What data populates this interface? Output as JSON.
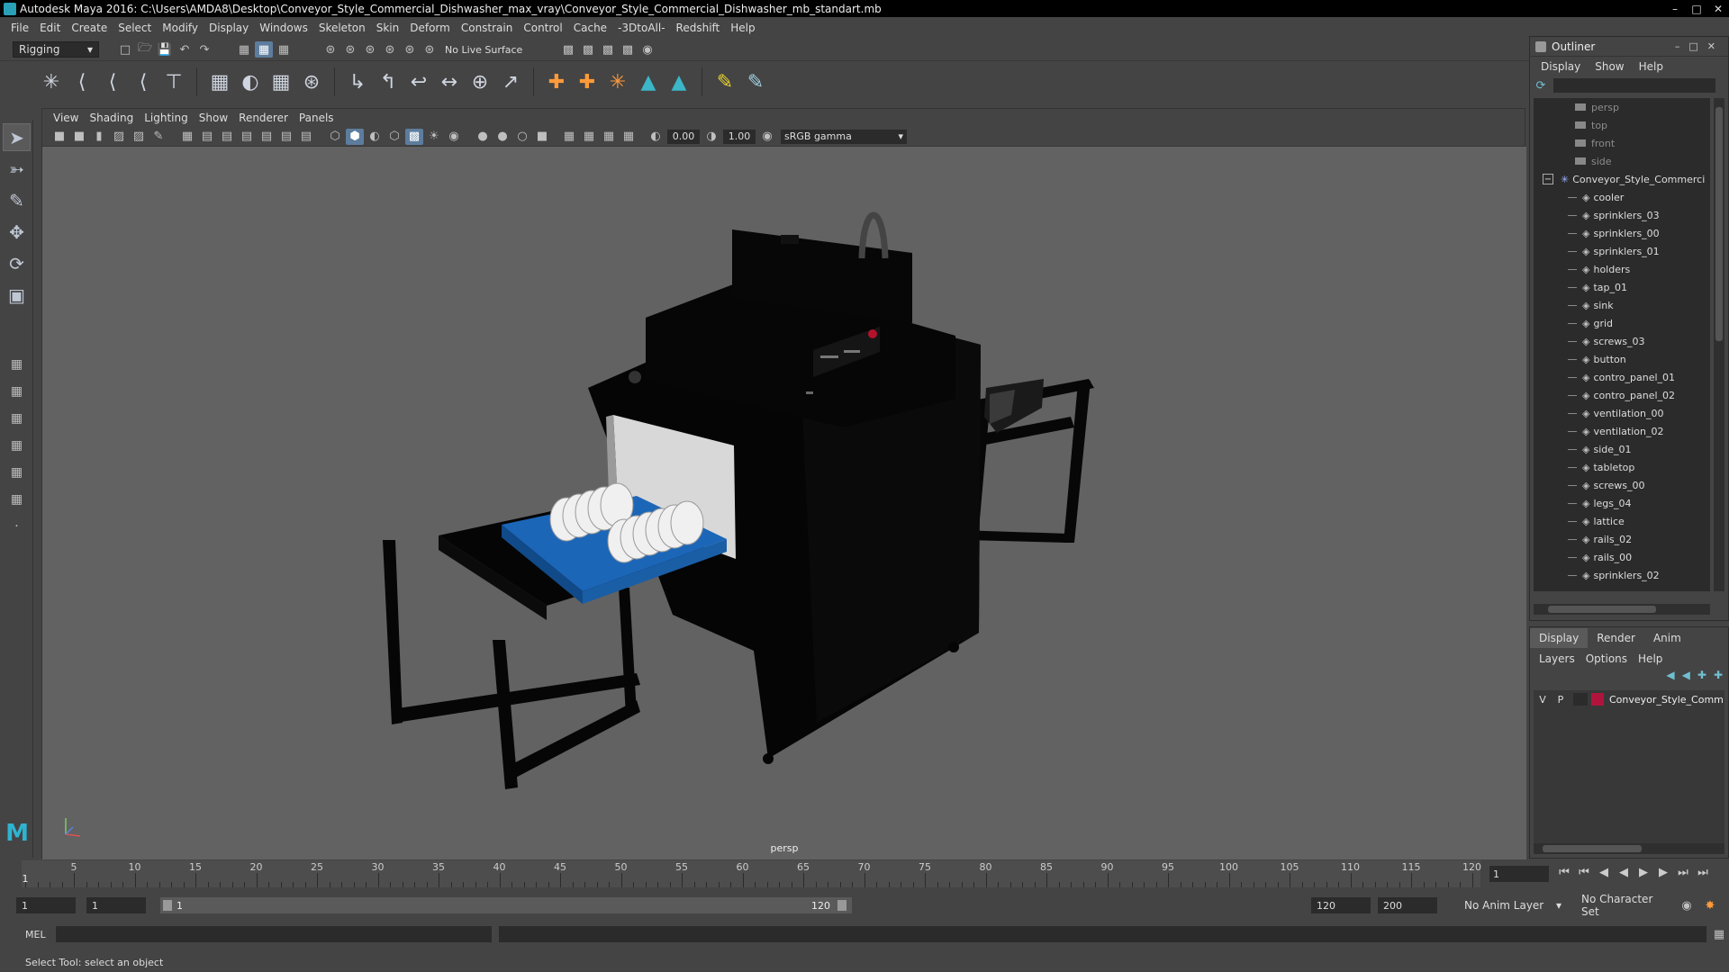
{
  "window": {
    "title": "Autodesk Maya 2016: C:\\Users\\AMDA8\\Desktop\\Conveyor_Style_Commercial_Dishwasher_max_vray\\Conveyor_Style_Commercial_Dishwasher_mb_standart.mb"
  },
  "menu": [
    "File",
    "Edit",
    "Create",
    "Select",
    "Modify",
    "Display",
    "Windows",
    "Skeleton",
    "Skin",
    "Deform",
    "Constrain",
    "Control",
    "Cache",
    "-3DtoAll-",
    "Redshift",
    "Help"
  ],
  "statusline": {
    "menuset": "Rigging",
    "live_surface": "No Live Surface"
  },
  "viewport": {
    "menu": [
      "View",
      "Shading",
      "Lighting",
      "Show",
      "Renderer",
      "Panels"
    ],
    "exposure": "0.00",
    "gamma": "1.00",
    "colorspace": "sRGB gamma",
    "camera_label": "persp"
  },
  "outliner": {
    "title": "Outliner",
    "menu": [
      "Display",
      "Show",
      "Help"
    ],
    "cameras": [
      "persp",
      "top",
      "front",
      "side"
    ],
    "root": "Conveyor_Style_Commerci",
    "children": [
      "cooler",
      "sprinklers_03",
      "sprinklers_00",
      "sprinklers_01",
      "holders",
      "tap_01",
      "sink",
      "grid",
      "screws_03",
      "button",
      "contro_panel_01",
      "contro_panel_02",
      "ventilation_00",
      "ventilation_02",
      "side_01",
      "tabletop",
      "screws_00",
      "legs_04",
      "lattice",
      "rails_02",
      "rails_00",
      "sprinklers_02"
    ]
  },
  "layer_editor": {
    "tabs": [
      "Display",
      "Render",
      "Anim"
    ],
    "menu": [
      "Layers",
      "Options",
      "Help"
    ],
    "layer": {
      "v": "V",
      "p": "P",
      "name": "Conveyor_Style_Comm",
      "color": "#b0143c"
    }
  },
  "timeline": {
    "ticks": [
      "5",
      "10",
      "15",
      "20",
      "25",
      "30",
      "35",
      "40",
      "45",
      "50",
      "55",
      "60",
      "65",
      "70",
      "75",
      "80",
      "85",
      "90",
      "95",
      "100",
      "105",
      "110",
      "115",
      "120"
    ],
    "current_frame_marker": "1",
    "current_frame": "1"
  },
  "range": {
    "start": "1",
    "anim_start": "1",
    "range_start": "1",
    "range_end": "120",
    "playback_end": "120",
    "anim_end": "200",
    "anim_layer": "No Anim Layer",
    "char_set": "No Character Set"
  },
  "cmdline": {
    "label": "MEL"
  },
  "help": {
    "text": "Select Tool: select an object"
  }
}
